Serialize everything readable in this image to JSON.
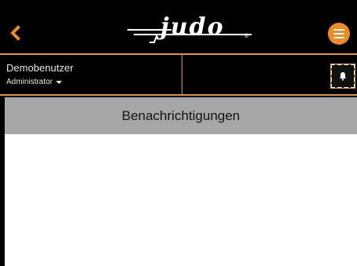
{
  "header": {
    "back_icon": "chevron-left-icon",
    "logo_text": "judo",
    "menu_icon": "hamburger-icon"
  },
  "user": {
    "name": "Demobenutzer",
    "role": "Administrator",
    "role_dropdown_icon": "caret-down-icon"
  },
  "notifications_icon": "bell-icon",
  "section": {
    "title": "Benachrichtigungen"
  },
  "colors": {
    "accent": "#f08a24",
    "background_dark": "#000000",
    "section_header": "#a6a6a6"
  }
}
